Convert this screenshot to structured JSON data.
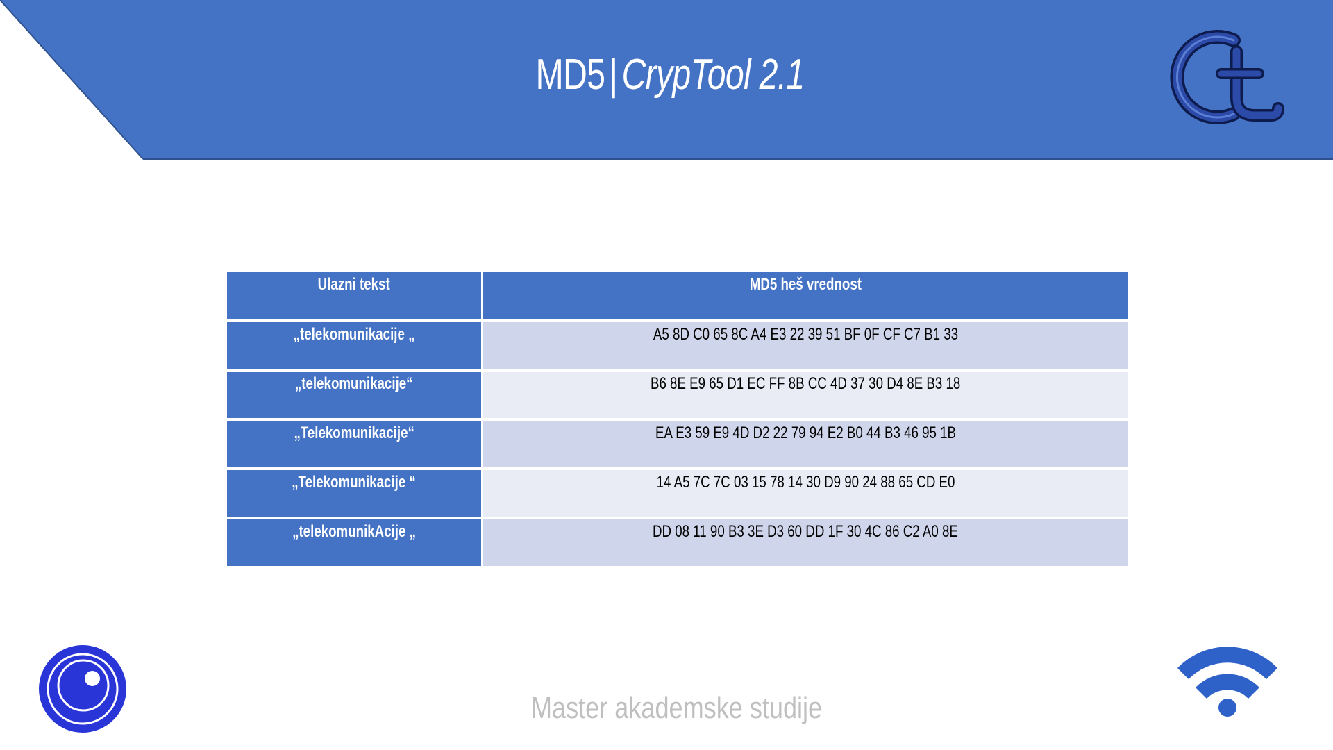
{
  "header": {
    "title_main": "MD5",
    "title_sep": "|",
    "title_italic": "CrypTool 2.1",
    "banner_color": "#4472c4"
  },
  "logos": {
    "top_right": "cryptool-ct-logo",
    "bottom_left": "camera-lens-icon",
    "bottom_right": "wifi-icon"
  },
  "table": {
    "headers": [
      "Ulazni tekst",
      "MD5 heš vrednost"
    ],
    "rows": [
      {
        "input": "„telekomunikacije „",
        "hash": "A5 8D C0 65 8C A4 E3 22 39 51 BF 0F CF C7 B1 33"
      },
      {
        "input": "„telekomunikacije“",
        "hash": "B6 8E E9 65 D1 EC FF 8B CC 4D 37 30 D4 8E B3 18"
      },
      {
        "input": "„Telekomunikacije“",
        "hash": "EA E3 59 E9 4D D2 22 79 94 E2 B0 44 B3 46 95 1B"
      },
      {
        "input": "„Telekomunikacije “",
        "hash": "14 A5 7C 7C 03 15 78 14 30 D9 90 24 88 65 CD E0"
      },
      {
        "input": "„telekomunikAcije „",
        "hash": "DD 08 11 90 B3 3E D3 60 DD 1F 30 4C 86 C2 A0 8E"
      }
    ],
    "header_color": "#4472c4",
    "row_colors": [
      "#cfd5ea",
      "#e9ebf5"
    ]
  },
  "footer": {
    "text": "Master akademske studije"
  }
}
